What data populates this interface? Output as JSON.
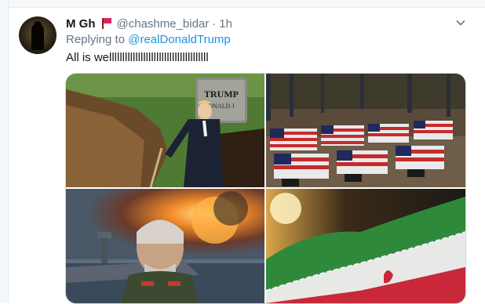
{
  "tweet": {
    "display_name": "M Gh",
    "handle": "@chashme_bidar",
    "separator": "·",
    "time": "1h",
    "reply_prefix": "Replying to",
    "reply_to": "@realDonaldTrump",
    "text": "All is wellllllllllllllllllllllllllllllllllllll",
    "name_badge_icon": "red-flag-icon",
    "menu_icon": "chevron-down-icon"
  },
  "media": {
    "gravestone_text": "TRUMP",
    "gravestone_subtext": "ONALD J",
    "count": 4
  },
  "colors": {
    "link": "#1b95e0",
    "muted": "#657786",
    "text": "#14171a",
    "flag": "#e0245e"
  }
}
